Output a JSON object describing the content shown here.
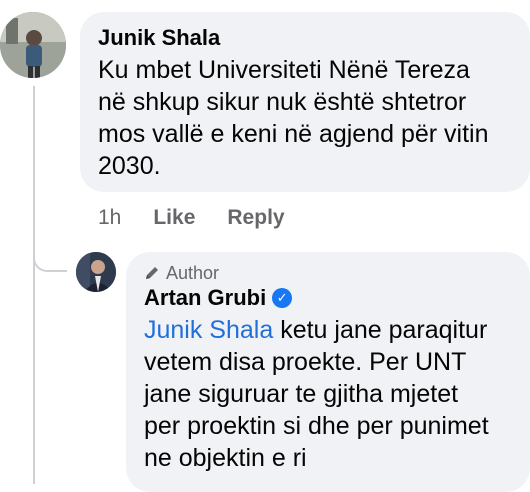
{
  "comments": [
    {
      "author": "Junik Shala",
      "text": "Ku mbet Universiteti Nënë Tereza\nnë shkup sikur nuk është shtetror\nmos vallë e keni në agjend për vitin\n2030.",
      "time": "1h",
      "like_label": "Like",
      "reply_label": "Reply"
    }
  ],
  "reply": {
    "badge_label": "Author",
    "author": "Artan Grubi",
    "mention": "Junik Shala",
    "text": " ketu jane paraqitur\nvetem disa proekte. Per UNT\njane siguruar te gjitha mjetet\nper proektin si dhe per punimet\nne objektin e ri"
  },
  "colors": {
    "bubble": "#f0f2f5",
    "mention": "#216fdb",
    "verified": "#1877f2",
    "meta": "#65676b"
  }
}
